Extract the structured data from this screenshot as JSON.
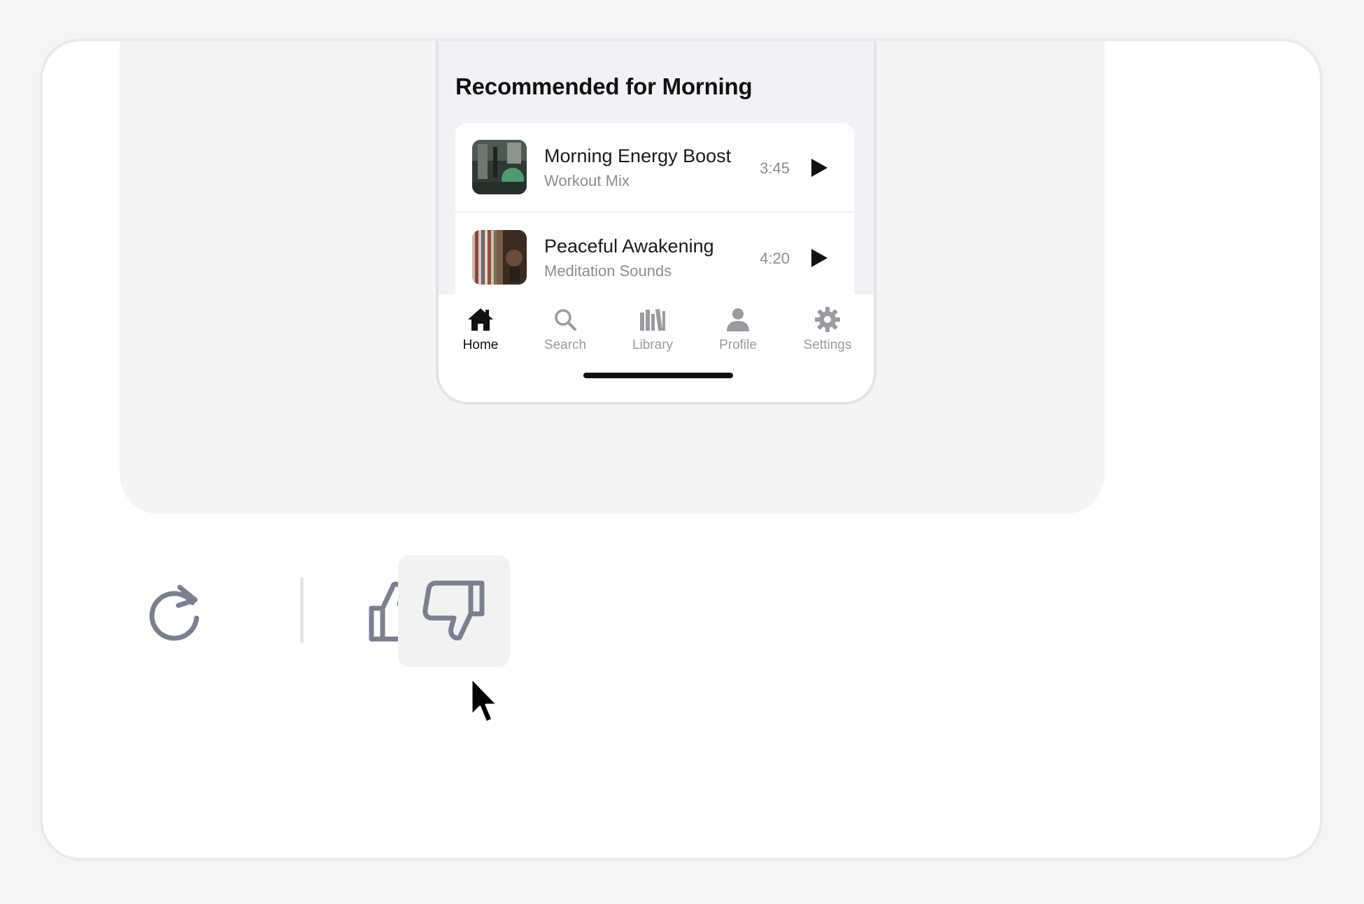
{
  "preview": {
    "section_title": "Recommended for Morning",
    "tracks": [
      {
        "title": "Morning Energy Boost",
        "subtitle": "Workout Mix",
        "duration": "3:45",
        "play_icon": "play-icon"
      },
      {
        "title": "Peaceful Awakening",
        "subtitle": "Meditation Sounds",
        "duration": "4:20",
        "play_icon": "play-icon"
      }
    ],
    "tabs": [
      {
        "label": "Home",
        "icon": "home-icon",
        "active": true
      },
      {
        "label": "Search",
        "icon": "search-icon",
        "active": false
      },
      {
        "label": "Library",
        "icon": "library-icon",
        "active": false
      },
      {
        "label": "Profile",
        "icon": "profile-icon",
        "active": false
      },
      {
        "label": "Settings",
        "icon": "gear-icon",
        "active": false
      }
    ]
  },
  "actions": {
    "items": [
      {
        "name": "regenerate",
        "icon": "refresh-icon"
      },
      {
        "name": "thumbs-up",
        "icon": "thumbs-up-icon"
      },
      {
        "name": "thumbs-down",
        "icon": "thumbs-down-icon",
        "hovered": true
      }
    ]
  },
  "colors": {
    "page_bg": "#f5f5f6",
    "card_border": "#e7eaf3",
    "preview_bg": "#f4f4f5",
    "icon_gray": "#7b8091",
    "active_tab": "#111111",
    "inactive_tab": "#9a9aa0"
  }
}
